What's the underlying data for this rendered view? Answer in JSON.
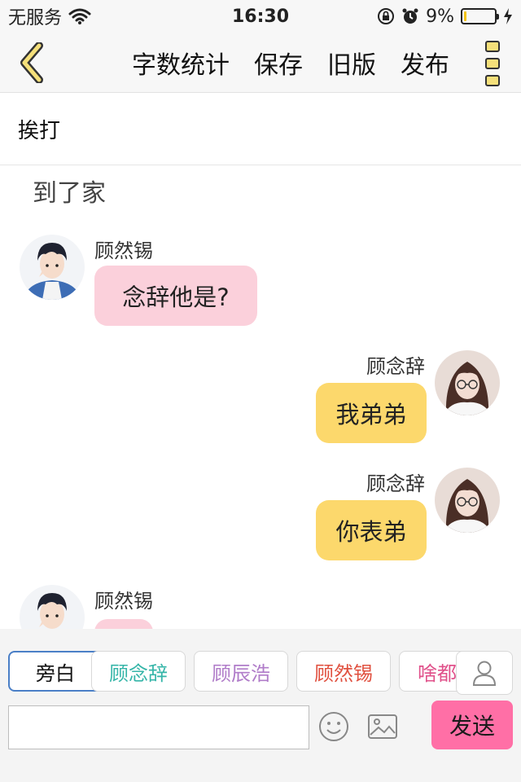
{
  "status_bar": {
    "carrier": "无服务",
    "time": "16:30",
    "battery_percent": "9%",
    "battery_level": 0.09,
    "icons": [
      "wifi-icon",
      "rotation-lock-icon",
      "alarm-icon",
      "charging-bolt-icon"
    ]
  },
  "nav": {
    "back_icon": "chevron-left-icon",
    "actions": {
      "word_count": "字数统计",
      "save": "保存",
      "old_version": "旧版",
      "publish": "发布"
    },
    "more_icon": "more-vertical-icon"
  },
  "chapter": {
    "title": "挨打"
  },
  "chat": {
    "narration": "到了家",
    "messages": [
      {
        "sender": "顾然锡",
        "text": "念辞他是?",
        "side": "left",
        "color": "#fbd0db"
      },
      {
        "sender": "顾念辞",
        "text": "我弟弟",
        "side": "right",
        "color": "#fcd86c"
      },
      {
        "sender": "顾念辞",
        "text": "你表弟",
        "side": "right",
        "color": "#fcd86c"
      },
      {
        "sender": "顾然锡",
        "text": "",
        "side": "left",
        "color": "#fbd0db"
      }
    ]
  },
  "characters": [
    {
      "name": "旁白",
      "color": "#111111",
      "selected": true
    },
    {
      "name": "顾念辞",
      "color": "#35b5a8",
      "selected": false
    },
    {
      "name": "顾辰浩",
      "color": "#b07cc9",
      "selected": false
    },
    {
      "name": "顾然锡",
      "color": "#e0503f",
      "selected": false
    },
    {
      "name": "啥都",
      "color": "#e0508a",
      "selected": false
    }
  ],
  "composer": {
    "input_value": "",
    "send_label": "发送",
    "send_color": "#ff6fa6"
  }
}
